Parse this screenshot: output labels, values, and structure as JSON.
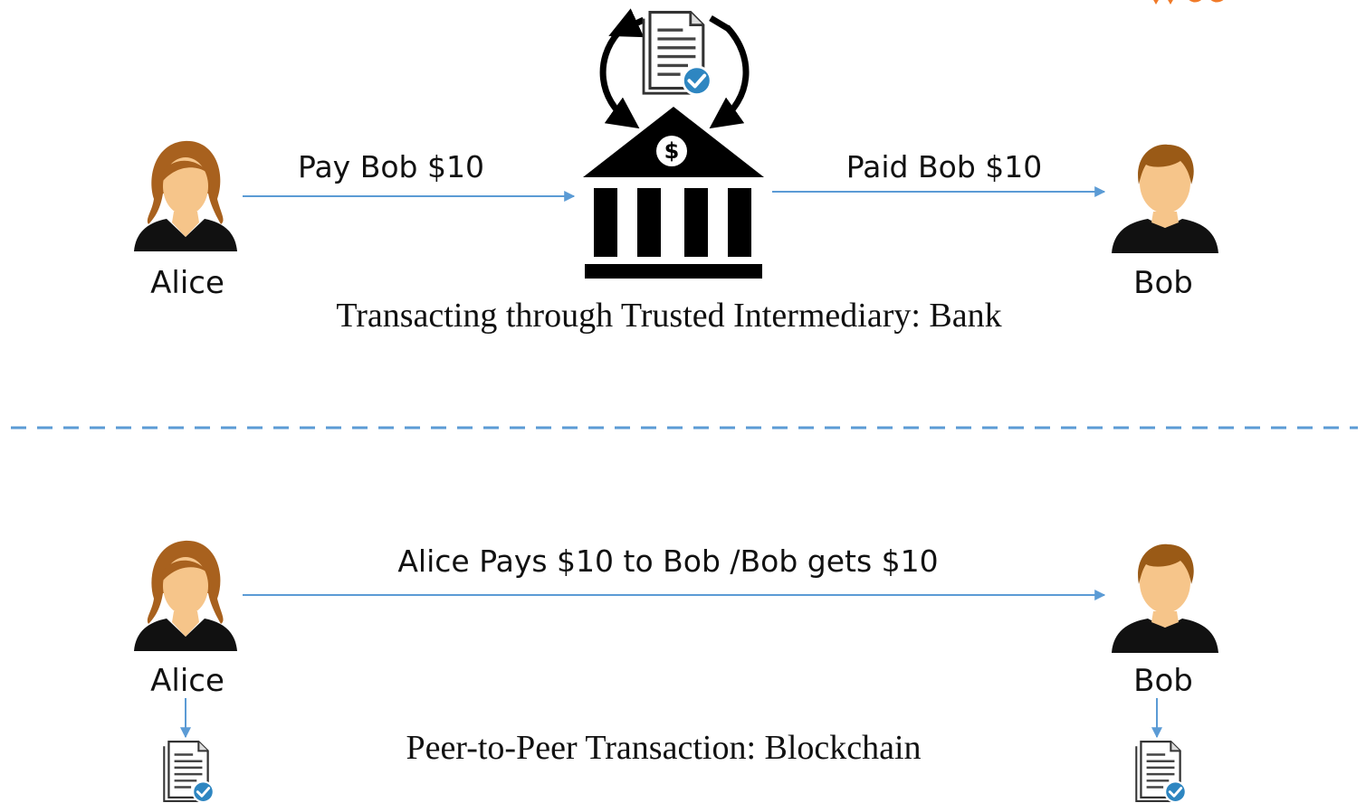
{
  "colors": {
    "arrow": "#5b9bd5",
    "divider": "#5b9bd5",
    "check": "#2e86c1",
    "skin": "#f6c58a",
    "hair_female": "#a8611e",
    "hair_male": "#9a5a16",
    "clothing": "#111111",
    "bank": "#000000",
    "corner_mark": "#f07a28"
  },
  "top": {
    "alice_label": "Alice",
    "bob_label": "Bob",
    "arrow_left_label": "Pay Bob $10",
    "arrow_right_label": "Paid Bob $10",
    "bank_symbol": "$",
    "caption": "Transacting through Trusted Intermediary: Bank"
  },
  "bottom": {
    "alice_label": "Alice",
    "bob_label": "Bob",
    "arrow_label": "Alice Pays $10 to Bob /Bob gets $10",
    "caption": "Peer-to-Peer Transaction: Blockchain"
  },
  "icons": {
    "female_user": "female-user-icon",
    "male_user": "male-user-icon",
    "bank": "bank-icon",
    "ledger_document": "verified-document-icon",
    "sync": "sync-arrows-icon"
  }
}
